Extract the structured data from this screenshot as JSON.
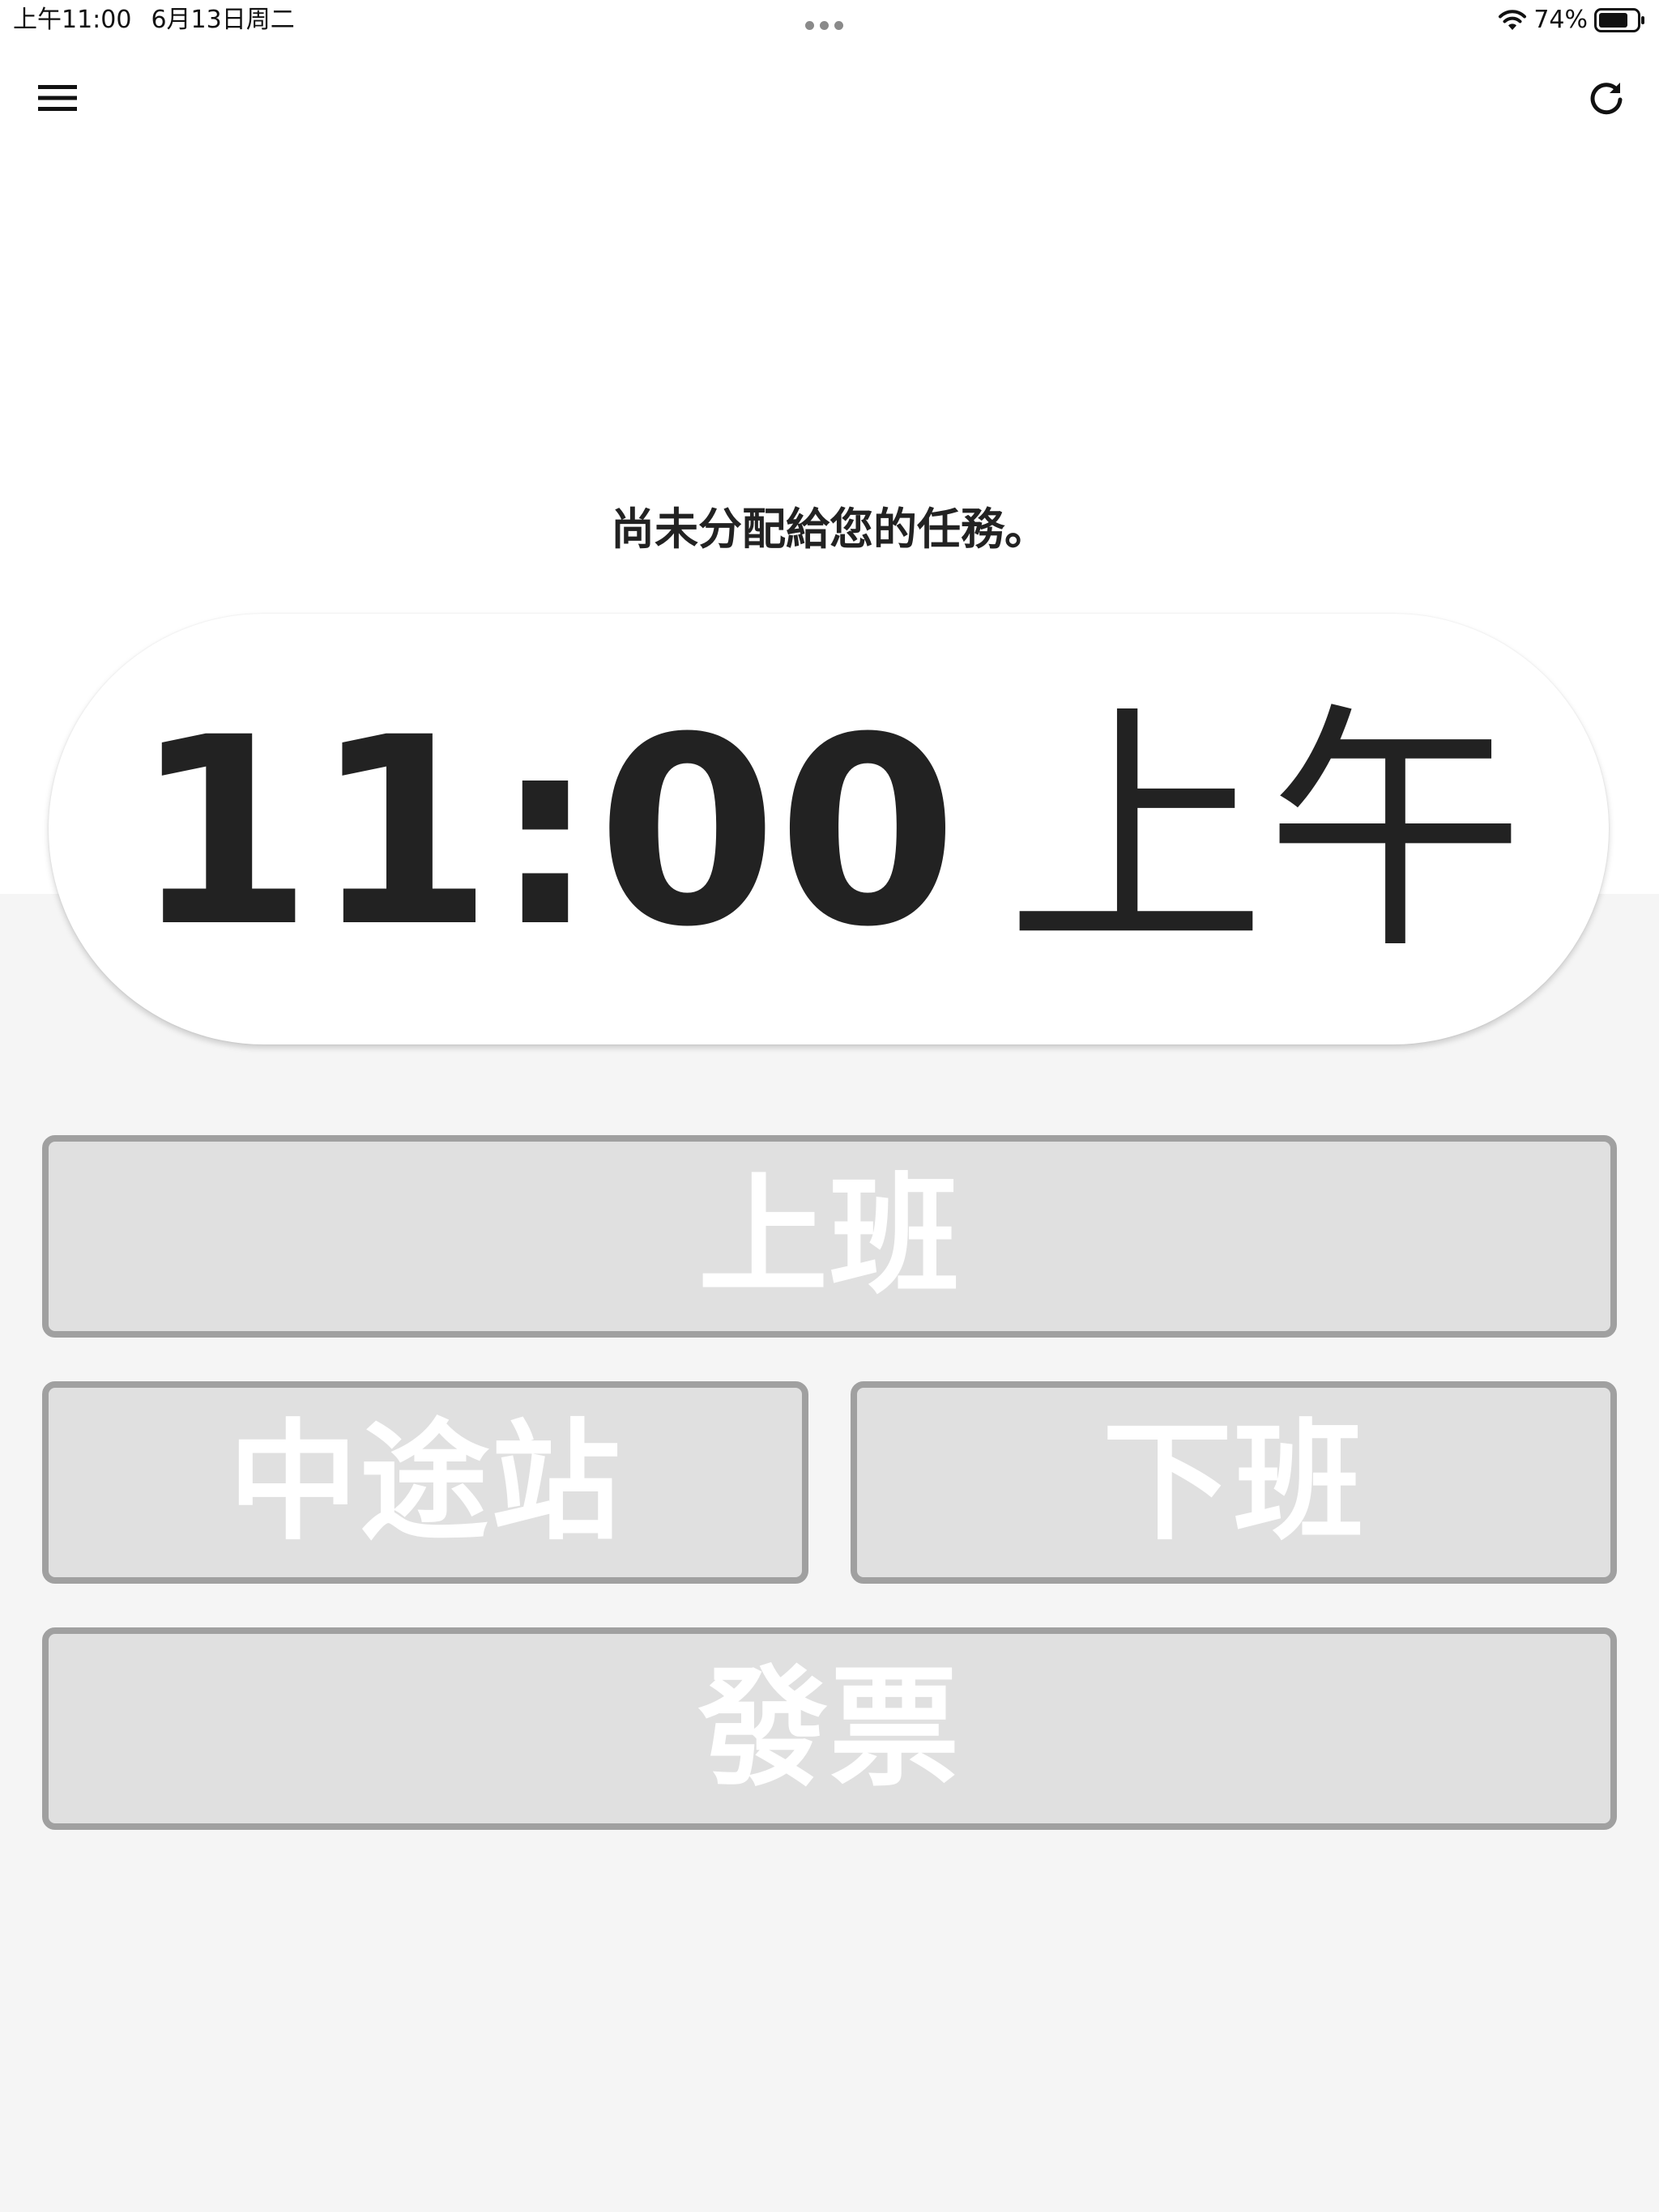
{
  "status_bar": {
    "time": "上午11:00",
    "date": "6月13日周二",
    "battery": "74%",
    "icons": [
      "wifi-icon",
      "battery-icon"
    ]
  },
  "app_bar": {
    "menu_icon": "hamburger-menu-icon",
    "refresh_icon": "refresh-icon"
  },
  "main": {
    "message": "尚未分配給您的任務。",
    "clock": {
      "time": "11:00",
      "ampm": "上午"
    },
    "buttons": {
      "clock_in": "上班",
      "waypoint": "中途站",
      "clock_out": "下班",
      "invoice": "發票"
    }
  },
  "colors": {
    "background": "#f5f5f5",
    "header_background": "#ffffff",
    "text": "#222222",
    "button_fill": "#e0e0e0",
    "button_border": "#a0a0a0",
    "button_text": "#ffffff"
  }
}
